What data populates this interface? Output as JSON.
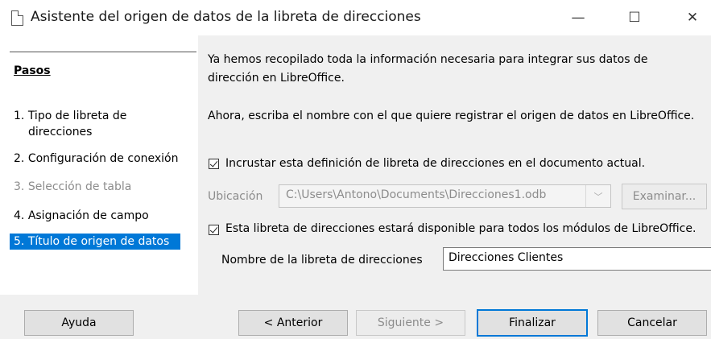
{
  "window": {
    "title": "Asistente del origen de datos de la libreta de direcciones",
    "minimize_glyph": "—",
    "maximize_glyph": "☐",
    "close_glyph": "✕"
  },
  "steps": {
    "heading": "Pasos",
    "items": [
      {
        "num": "1.",
        "label_line1": "Tipo de libreta de",
        "label_line2": "direcciones",
        "state": "normal"
      },
      {
        "num": "2.",
        "label": "Configuración de conexión",
        "state": "normal"
      },
      {
        "num": "3.",
        "label": "Selección de tabla",
        "state": "disabled"
      },
      {
        "num": "4.",
        "label": "Asignación de campo",
        "state": "normal"
      },
      {
        "num": "5.",
        "label": "Título de origen de datos",
        "state": "selected"
      }
    ]
  },
  "content": {
    "intro_line1": "Ya hemos recopilado toda la información necesaria para integrar sus datos de",
    "intro_line2": "dirección en LibreOffice.",
    "instruction": "Ahora, escriba el nombre con el que quiere registrar el origen de datos en LibreOffice.",
    "embed_checkbox": {
      "label": "Incrustar esta definición de libreta de direcciones en el documento actual.",
      "checked": true
    },
    "location": {
      "label": "Ubicación",
      "value": "C:\\Users\\Antono\\Documents\\Direcciones1.odb",
      "browse_label": "Examinar..."
    },
    "available_checkbox": {
      "label": "Esta libreta de direcciones estará disponible para todos los módulos de LibreOffice.",
      "checked": true
    },
    "name_field": {
      "label": "Nombre de la libreta de direcciones",
      "value": "Direcciones Clientes"
    }
  },
  "buttons": {
    "help": "Ayuda",
    "back": "< Anterior",
    "next": "Siguiente >",
    "finish": "Finalizar",
    "cancel": "Cancelar"
  },
  "colors": {
    "selection": "#0078d7",
    "disabled_text": "#8c8c8c"
  }
}
